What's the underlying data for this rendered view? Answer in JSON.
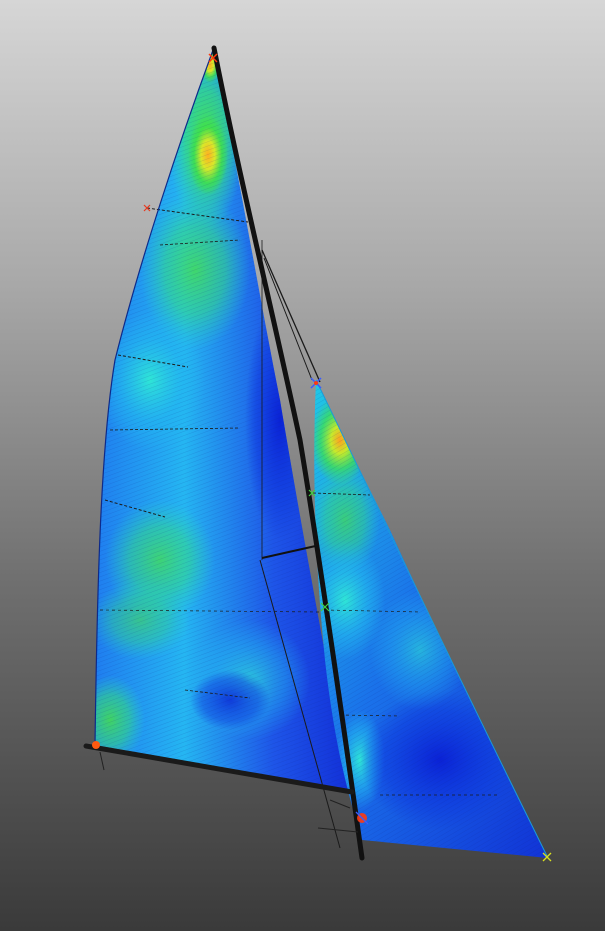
{
  "scene": {
    "subject": "sail-stress-visualization",
    "background": {
      "top": "#d6d6d6",
      "bottom": "#3a3a3a"
    },
    "colormap": {
      "low": "#0a2fe0",
      "mid_low": "#1fa8ff",
      "mid": "#2ee8c8",
      "mid_high": "#39e63a",
      "high": "#ff8a10",
      "peak": "#ff2a10"
    },
    "rig": {
      "mast_color": "#111111",
      "boom_color": "#1a1a1a",
      "batten_color": "#1b1b1b"
    }
  }
}
